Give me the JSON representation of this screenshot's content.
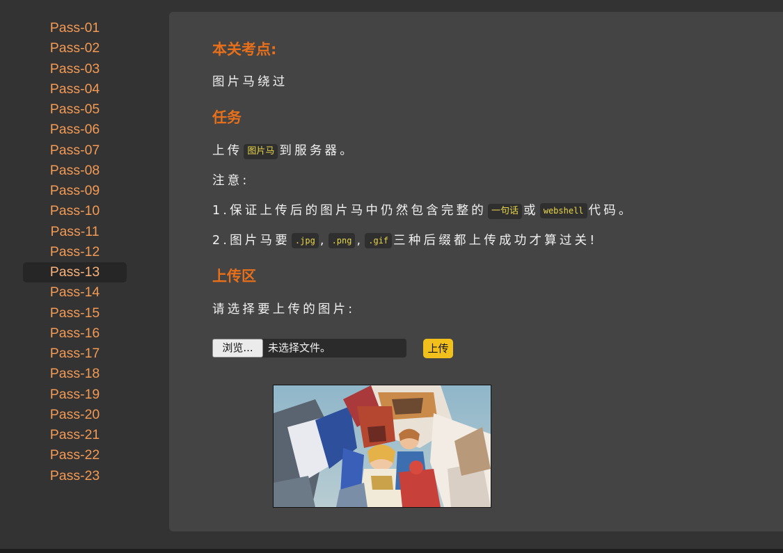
{
  "sidebar": {
    "items": [
      {
        "label": "Pass-01"
      },
      {
        "label": "Pass-02"
      },
      {
        "label": "Pass-03"
      },
      {
        "label": "Pass-04"
      },
      {
        "label": "Pass-05"
      },
      {
        "label": "Pass-06"
      },
      {
        "label": "Pass-07"
      },
      {
        "label": "Pass-08"
      },
      {
        "label": "Pass-09"
      },
      {
        "label": "Pass-10"
      },
      {
        "label": "Pass-11"
      },
      {
        "label": "Pass-12"
      },
      {
        "label": "Pass-13"
      },
      {
        "label": "Pass-14"
      },
      {
        "label": "Pass-15"
      },
      {
        "label": "Pass-16"
      },
      {
        "label": "Pass-17"
      },
      {
        "label": "Pass-18"
      },
      {
        "label": "Pass-19"
      },
      {
        "label": "Pass-20"
      },
      {
        "label": "Pass-21"
      },
      {
        "label": "Pass-22"
      },
      {
        "label": "Pass-23"
      }
    ],
    "active_item": "Pass-13"
  },
  "main": {
    "topic": {
      "heading": "本关考点:",
      "text": "图片马绕过"
    },
    "task": {
      "heading": "任务",
      "line1_before": "上传",
      "line1_code": "图片马",
      "line1_after": "到服务器。",
      "note_label": "注意:",
      "rule1_before": "1.保证上传后的图片马中仍然包含完整的",
      "rule1_code1": "一句话",
      "rule1_mid": "或",
      "rule1_code2": "webshell",
      "rule1_after": "代码。",
      "rule2_before": "2.图片马要",
      "rule2_code1": ".jpg",
      "rule2_sep1": ",",
      "rule2_code2": ".png",
      "rule2_sep2": ",",
      "rule2_code3": ".gif",
      "rule2_after": "三种后缀都上传成功才算过关!"
    },
    "upload_area": {
      "heading": "上传区",
      "prompt": "请选择要上传的图片:",
      "browse_label": "浏览...",
      "file_status": "未选择文件。",
      "submit_label": "上传"
    }
  },
  "colors": {
    "page_bg": "#333333",
    "panel_bg": "#444444",
    "accent": "#e8701a",
    "nav_link": "#f39a55",
    "code_text": "#e8d64a",
    "upload_button": "#f2c01d"
  }
}
